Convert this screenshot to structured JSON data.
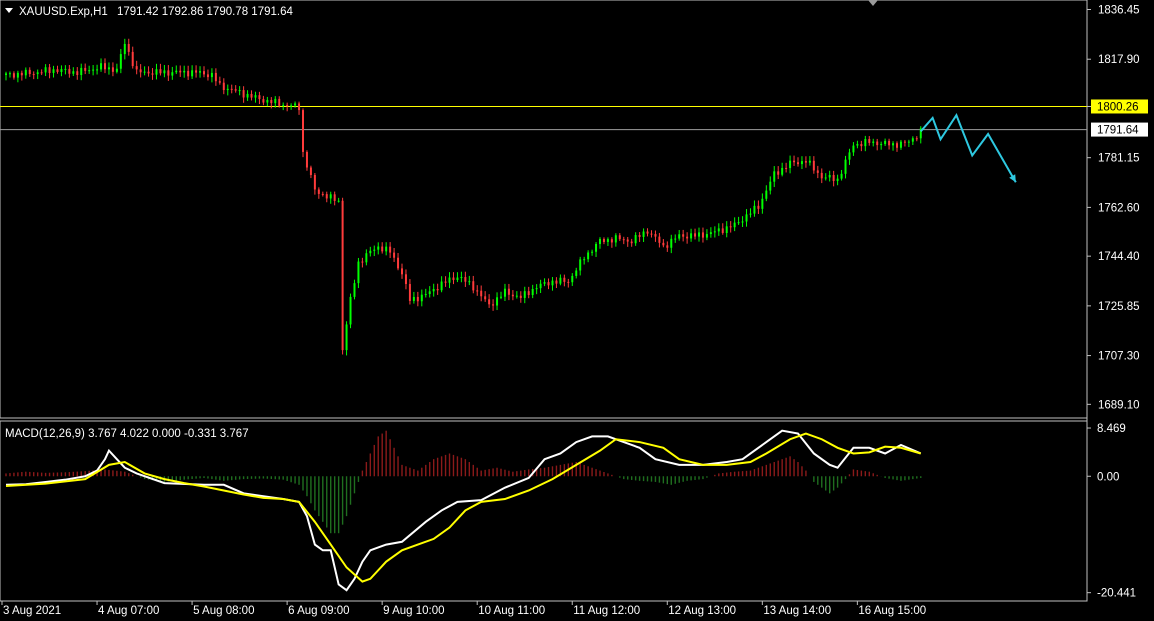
{
  "header": {
    "symbol": "XAUUSD.Exp,H1",
    "ohlc": "1791.42 1792.86 1790.78 1791.64",
    "macd": "MACD(12,26,9) 3.767 4.022 0.000 -0.331 3.767"
  },
  "colors": {
    "background": "#000000",
    "bull": "#00ff00",
    "bear": "#ff3b3b",
    "signal": "#ffff00",
    "macd_line": "#ffffff",
    "hist_pos": "#8b1a1a",
    "hist_neg": "#1f6e1f",
    "forecast": "#2ec8e0",
    "level_line": "#ffff00",
    "price_line": "#9e9e9e",
    "grid": "#c0c0c0"
  },
  "chart_data": [
    {
      "type": "candlestick",
      "title": "XAUUSD.Exp,H1",
      "y_ticks": [
        "1836.45",
        "1817.90",
        "1800.26",
        "1781.15",
        "1762.60",
        "1744.40",
        "1725.85",
        "1707.30",
        "1689.10"
      ],
      "y_tick_values": [
        1836.45,
        1817.9,
        1800.26,
        1781.15,
        1762.6,
        1744.4,
        1725.85,
        1707.3,
        1689.1
      ],
      "ylim": [
        1684,
        1840
      ],
      "x_ticks": [
        "3 Aug 2021",
        "4 Aug 07:00",
        "5 Aug 08:00",
        "6 Aug 09:00",
        "9 Aug 10:00",
        "10 Aug 11:00",
        "11 Aug 12:00",
        "12 Aug 13:00",
        "13 Aug 14:00",
        "16 Aug 15:00"
      ],
      "horizontal_level": {
        "label": "1800.26",
        "value": 1800.26
      },
      "current_price": {
        "label": "1791.64",
        "value": 1791.64
      },
      "close_path": [
        [
          0,
          1812
        ],
        [
          8,
          1813
        ],
        [
          12,
          1814
        ],
        [
          18,
          1813
        ],
        [
          24,
          1815
        ],
        [
          28,
          1814
        ],
        [
          30,
          1824
        ],
        [
          33,
          1813
        ],
        [
          40,
          1813
        ],
        [
          48,
          1813
        ],
        [
          52,
          1812
        ],
        [
          54,
          1808
        ],
        [
          58,
          1806
        ],
        [
          64,
          1803
        ],
        [
          70,
          1801
        ],
        [
          74,
          1800
        ],
        [
          75,
          1783
        ],
        [
          78,
          1769
        ],
        [
          82,
          1766
        ],
        [
          84,
          1765
        ],
        [
          85,
          1710
        ],
        [
          87,
          1728
        ],
        [
          89,
          1742
        ],
        [
          92,
          1746
        ],
        [
          94,
          1748
        ],
        [
          97,
          1746
        ],
        [
          100,
          1738
        ],
        [
          102,
          1728
        ],
        [
          106,
          1730
        ],
        [
          110,
          1734
        ],
        [
          114,
          1737
        ],
        [
          118,
          1733
        ],
        [
          122,
          1726
        ],
        [
          126,
          1731
        ],
        [
          130,
          1729
        ],
        [
          134,
          1733
        ],
        [
          138,
          1735
        ],
        [
          142,
          1735
        ],
        [
          146,
          1744
        ],
        [
          150,
          1750
        ],
        [
          154,
          1751
        ],
        [
          158,
          1750
        ],
        [
          162,
          1754
        ],
        [
          166,
          1748
        ],
        [
          170,
          1752
        ],
        [
          174,
          1752
        ],
        [
          178,
          1753
        ],
        [
          184,
          1756
        ],
        [
          190,
          1763
        ],
        [
          194,
          1775
        ],
        [
          198,
          1779
        ],
        [
          202,
          1780
        ],
        [
          206,
          1774
        ],
        [
          210,
          1773
        ],
        [
          214,
          1786
        ],
        [
          218,
          1787
        ],
        [
          224,
          1786
        ],
        [
          228,
          1787
        ],
        [
          231,
          1791
        ]
      ],
      "forecast_path": [
        [
          231,
          1791
        ],
        [
          234,
          1796
        ],
        [
          236,
          1788
        ],
        [
          240,
          1797
        ],
        [
          244,
          1782
        ],
        [
          248,
          1790
        ],
        [
          255,
          1772
        ]
      ]
    },
    {
      "type": "macd",
      "title": "MACD(12,26,9) 3.767 4.022 0.000 -0.331 3.767",
      "y_ticks": [
        "8.469",
        "0.00",
        "-20.441"
      ],
      "y_tick_values": [
        8.469,
        0,
        -20.441
      ],
      "ylim": [
        -21.2,
        9.0
      ],
      "histogram": [
        [
          0,
          0.5
        ],
        [
          5,
          0.8
        ],
        [
          10,
          0.6
        ],
        [
          15,
          0.7
        ],
        [
          20,
          0.9
        ],
        [
          25,
          1.2
        ],
        [
          30,
          0.8
        ],
        [
          35,
          -0.5
        ],
        [
          40,
          -1.0
        ],
        [
          45,
          -0.6
        ],
        [
          50,
          -0.3
        ],
        [
          55,
          -0.8
        ],
        [
          60,
          -0.5
        ],
        [
          65,
          -0.4
        ],
        [
          70,
          -0.6
        ],
        [
          74,
          -1.5
        ],
        [
          76,
          -3.5
        ],
        [
          78,
          -6
        ],
        [
          80,
          -8
        ],
        [
          82,
          -10
        ],
        [
          84,
          -10
        ],
        [
          86,
          -7
        ],
        [
          88,
          -3
        ],
        [
          90,
          1
        ],
        [
          92,
          4
        ],
        [
          94,
          7
        ],
        [
          96,
          8
        ],
        [
          98,
          5
        ],
        [
          100,
          2
        ],
        [
          104,
          1
        ],
        [
          108,
          3
        ],
        [
          112,
          4
        ],
        [
          116,
          3
        ],
        [
          120,
          1
        ],
        [
          124,
          1.5
        ],
        [
          128,
          0.8
        ],
        [
          132,
          1.2
        ],
        [
          136,
          1.5
        ],
        [
          140,
          2
        ],
        [
          144,
          2.5
        ],
        [
          148,
          1.5
        ],
        [
          152,
          0.5
        ],
        [
          156,
          -0.5
        ],
        [
          160,
          -0.8
        ],
        [
          164,
          -1
        ],
        [
          168,
          -1.5
        ],
        [
          172,
          -0.8
        ],
        [
          176,
          -0.5
        ],
        [
          180,
          0.5
        ],
        [
          184,
          0.8
        ],
        [
          188,
          1
        ],
        [
          192,
          2
        ],
        [
          196,
          3
        ],
        [
          198,
          3.5
        ],
        [
          200,
          2.5
        ],
        [
          202,
          1
        ],
        [
          204,
          -1
        ],
        [
          206,
          -2
        ],
        [
          208,
          -3
        ],
        [
          210,
          -2
        ],
        [
          212,
          -0.5
        ],
        [
          214,
          1.2
        ],
        [
          218,
          0.8
        ],
        [
          222,
          -0.3
        ],
        [
          226,
          -0.8
        ],
        [
          231,
          -0.3
        ]
      ],
      "series": [
        {
          "values": [
            [
              0,
              -1.5
            ],
            [
              5,
              -1.4
            ],
            [
              10,
              -1.0
            ],
            [
              15,
              -0.6
            ],
            [
              20,
              0
            ],
            [
              23,
              1
            ],
            [
              25,
              3
            ],
            [
              26,
              4.5
            ],
            [
              28,
              3
            ],
            [
              30,
              1.5
            ],
            [
              33,
              0.5
            ],
            [
              40,
              -1.2
            ],
            [
              50,
              -1.5
            ],
            [
              55,
              -1.5
            ],
            [
              60,
              -3
            ],
            [
              65,
              -3.5
            ],
            [
              70,
              -4
            ],
            [
              74,
              -4.5
            ],
            [
              76,
              -7
            ],
            [
              78,
              -12
            ],
            [
              80,
              -13
            ],
            [
              82,
              -13
            ],
            [
              84,
              -19
            ],
            [
              86,
              -20
            ],
            [
              88,
              -18
            ],
            [
              90,
              -15
            ],
            [
              92,
              -13
            ],
            [
              96,
              -12
            ],
            [
              100,
              -11.5
            ],
            [
              106,
              -8
            ],
            [
              110,
              -6
            ],
            [
              114,
              -4.5
            ],
            [
              120,
              -4.2
            ],
            [
              126,
              -2
            ],
            [
              132,
              -0.3
            ],
            [
              136,
              3
            ],
            [
              140,
              4
            ],
            [
              144,
              6
            ],
            [
              148,
              7
            ],
            [
              152,
              7
            ],
            [
              156,
              6
            ],
            [
              160,
              5
            ],
            [
              164,
              3
            ],
            [
              170,
              2
            ],
            [
              176,
              2
            ],
            [
              182,
              2.5
            ],
            [
              186,
              3
            ],
            [
              192,
              6
            ],
            [
              196,
              8
            ],
            [
              200,
              7.5
            ],
            [
              204,
              4
            ],
            [
              208,
              2
            ],
            [
              210,
              1.5
            ],
            [
              214,
              5
            ],
            [
              218,
              5
            ],
            [
              222,
              4
            ],
            [
              226,
              5.5
            ],
            [
              231,
              4.0
            ]
          ]
        },
        {
          "values": [
            [
              0,
              -1.7
            ],
            [
              10,
              -1.3
            ],
            [
              20,
              -0.5
            ],
            [
              26,
              2
            ],
            [
              30,
              2.5
            ],
            [
              35,
              0.5
            ],
            [
              40,
              -0.5
            ],
            [
              45,
              -1.2
            ],
            [
              50,
              -1.8
            ],
            [
              55,
              -2.5
            ],
            [
              60,
              -3.2
            ],
            [
              65,
              -3.8
            ],
            [
              70,
              -4
            ],
            [
              74,
              -4.5
            ],
            [
              78,
              -8
            ],
            [
              82,
              -12
            ],
            [
              86,
              -16
            ],
            [
              90,
              -18.5
            ],
            [
              92,
              -18
            ],
            [
              96,
              -15
            ],
            [
              100,
              -13
            ],
            [
              104,
              -12
            ],
            [
              108,
              -11
            ],
            [
              112,
              -9
            ],
            [
              116,
              -6
            ],
            [
              120,
              -4.5
            ],
            [
              126,
              -4
            ],
            [
              132,
              -2.5
            ],
            [
              138,
              -0.5
            ],
            [
              144,
              2
            ],
            [
              150,
              4.5
            ],
            [
              154,
              6.5
            ],
            [
              160,
              6
            ],
            [
              166,
              5
            ],
            [
              170,
              3
            ],
            [
              176,
              2
            ],
            [
              182,
              2
            ],
            [
              188,
              2.5
            ],
            [
              192,
              4
            ],
            [
              198,
              6.5
            ],
            [
              202,
              7.5
            ],
            [
              206,
              6.5
            ],
            [
              210,
              5
            ],
            [
              214,
              4
            ],
            [
              218,
              4.2
            ],
            [
              222,
              5.2
            ],
            [
              226,
              5
            ],
            [
              231,
              4.0
            ]
          ]
        }
      ]
    }
  ]
}
